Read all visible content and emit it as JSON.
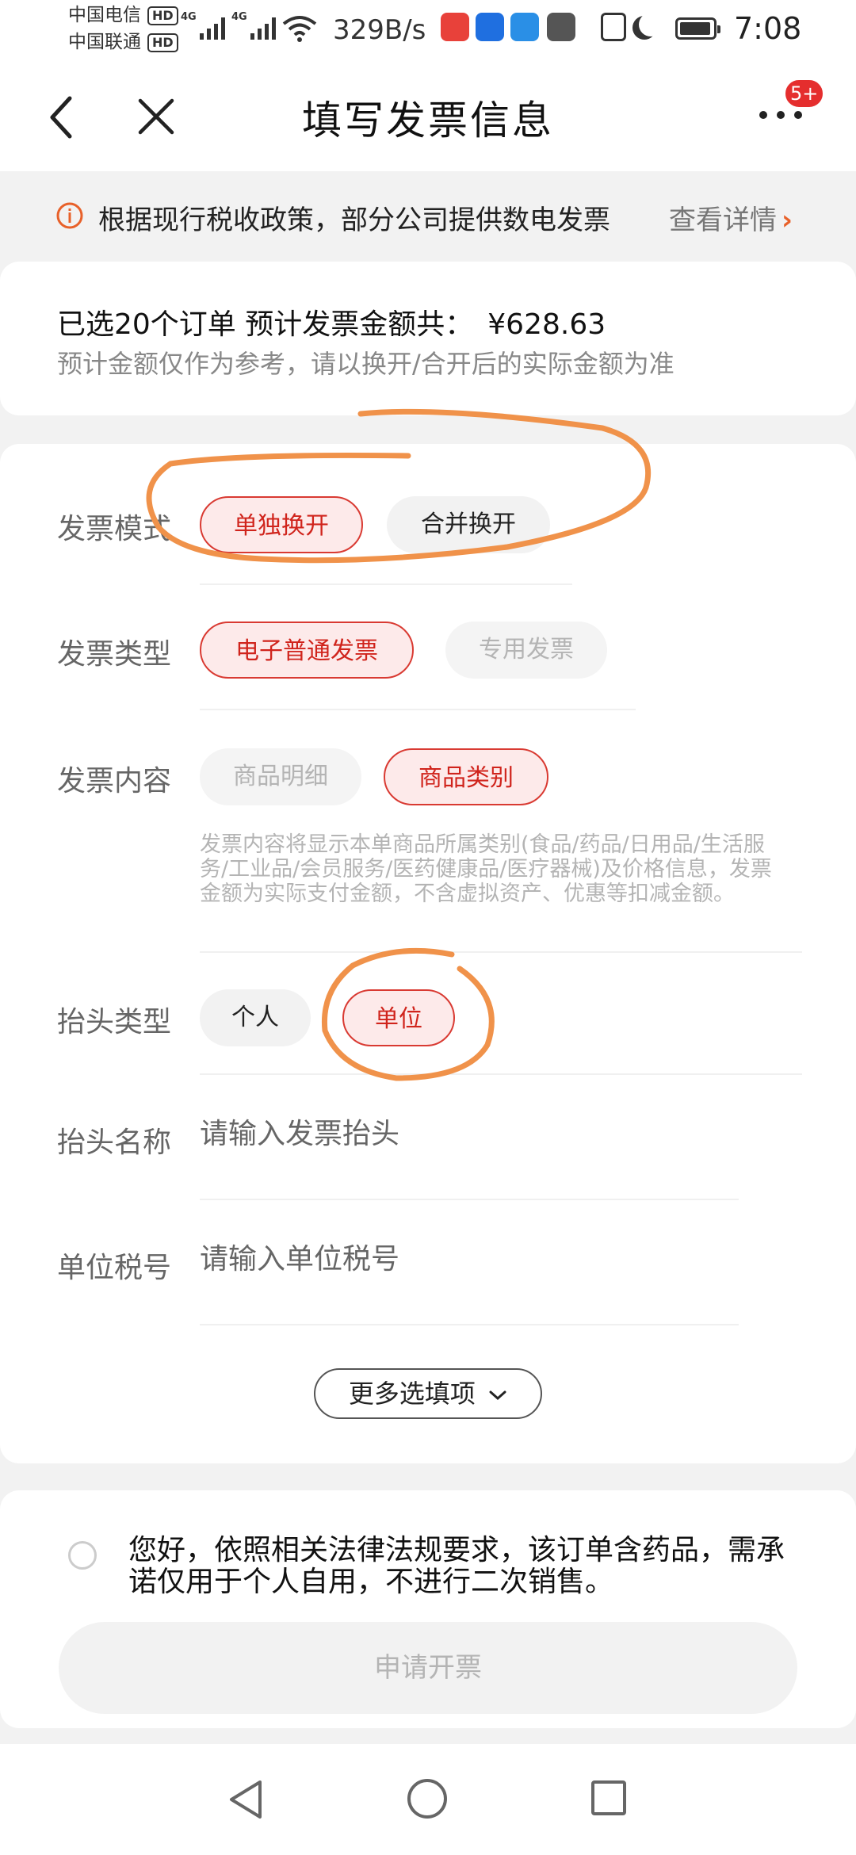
{
  "status_bar": {
    "carrier1": "中国电信",
    "carrier2": "中国联通",
    "hd": "HD",
    "sig": "4G",
    "net_speed": "329B/s",
    "time": "7:08"
  },
  "header": {
    "title": "填写发票信息",
    "badge": "5+"
  },
  "notice": {
    "text": "根据现行税收政策，部分公司提供数电发票",
    "link": "查看详情",
    "arrow": "›"
  },
  "summary": {
    "selected": "已选20个订单 预计发票金额共：",
    "amount": "¥628.63",
    "hint": "预计金额仅作为参考，请以换开/合开后的实际金额为准"
  },
  "form": {
    "mode": {
      "label": "发票模式",
      "options": [
        "单独换开",
        "合并换开"
      ],
      "selected": "单独换开"
    },
    "type": {
      "label": "发票类型",
      "options": [
        "电子普通发票",
        "专用发票"
      ],
      "selected": "电子普通发票"
    },
    "content": {
      "label": "发票内容",
      "options": [
        "商品明细",
        "商品类别"
      ],
      "selected": "商品类别",
      "description": "发票内容将显示本单商品所属类别(食品/药品/日用品/生活服务/工业品/会员服务/医药健康品/医疗器械)及价格信息，发票金额为实际支付金额，不含虚拟资产、优惠等扣减金额。"
    },
    "title_type": {
      "label": "抬头类型",
      "options": [
        "个人",
        "单位"
      ],
      "selected": "单位"
    },
    "title_name": {
      "label": "抬头名称",
      "placeholder": "请输入发票抬头",
      "value": ""
    },
    "tax_id": {
      "label": "单位税号",
      "placeholder": "请输入单位税号",
      "value": ""
    },
    "more_options": "更多选填项",
    "more_icon": "chevron-down-icon"
  },
  "bottom": {
    "commitment": "您好，依照相关法律法规要求，该订单含药品，需承诺仅用于个人自用，不进行二次销售。",
    "checked": false,
    "submit": "申请开票"
  },
  "colors": {
    "accent": "#d93a32",
    "accent_bg": "#fdeaea",
    "annotation": "#f0924a",
    "badge": "#e52e2e"
  }
}
